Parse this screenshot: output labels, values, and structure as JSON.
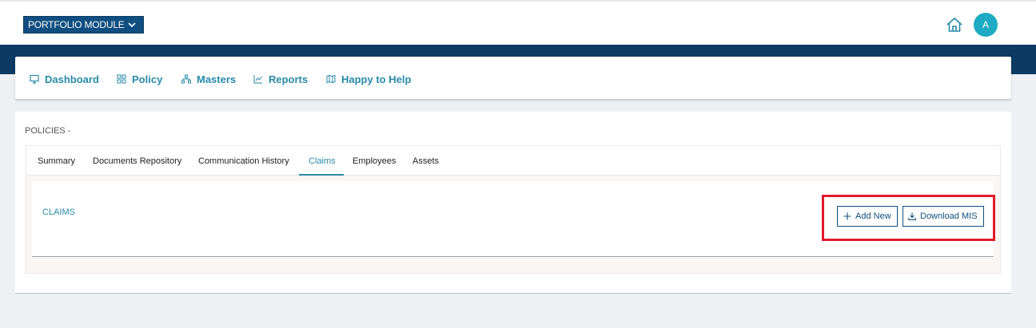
{
  "header": {
    "module_label": "PORTFOLIO MODULE",
    "avatar_initial": "A",
    "accent_color": "#0f4e7f",
    "avatar_color": "#1eaac3"
  },
  "nav": {
    "items": [
      {
        "label": "Dashboard",
        "icon": "monitor-icon"
      },
      {
        "label": "Policy",
        "icon": "grid-icon"
      },
      {
        "label": "Masters",
        "icon": "hierarchy-icon"
      },
      {
        "label": "Reports",
        "icon": "line-chart-icon"
      },
      {
        "label": "Happy to Help",
        "icon": "map-icon"
      }
    ]
  },
  "policies": {
    "title": "POLICIES -",
    "tabs": [
      "Summary",
      "Documents Repository",
      "Communication History",
      "Claims",
      "Employees",
      "Assets"
    ],
    "active_tab": "Claims"
  },
  "claims": {
    "title": "CLAIMS",
    "add_new_label": "Add New",
    "download_label": "Download MIS"
  },
  "highlight_color": "#e21a2c"
}
